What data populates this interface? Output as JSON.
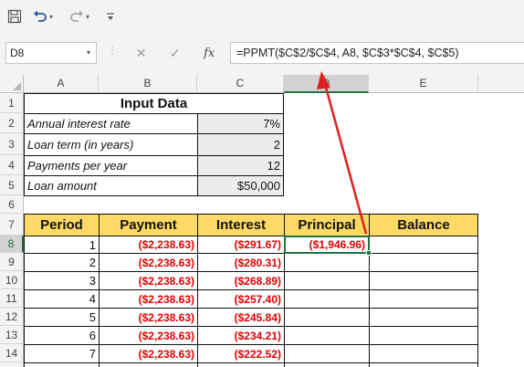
{
  "toolbar": {
    "save_icon": "save-icon",
    "undo_icon": "undo-icon",
    "redo_icon": "redo-icon",
    "customize_icon": "customize-qat-icon"
  },
  "formula_bar": {
    "name_box": "D8",
    "cancel_glyph": "✕",
    "enter_glyph": "✓",
    "fx_label": "fx",
    "formula": "=PPMT($C$2/$C$4, A8, $C$3*$C$4, $C$5)"
  },
  "columns": [
    "A",
    "B",
    "C",
    "D",
    "E"
  ],
  "rows": [
    "1",
    "2",
    "3",
    "4",
    "5",
    "6",
    "7",
    "8",
    "9",
    "10",
    "11",
    "12",
    "13",
    "14"
  ],
  "input": {
    "title": "Input Data",
    "labels": [
      "Annual interest rate",
      "Loan term (in years)",
      "Payments per year",
      "Loan amount"
    ],
    "values": [
      "7%",
      "2",
      "12",
      "$50,000"
    ]
  },
  "table": {
    "headers": [
      "Period",
      "Payment",
      "Interest",
      "Principal",
      "Balance"
    ],
    "rows": [
      {
        "period": "1",
        "payment": "($2,238.63)",
        "interest": "($291.67)",
        "principal": "($1,946.96)",
        "balance": ""
      },
      {
        "period": "2",
        "payment": "($2,238.63)",
        "interest": "($280.31)",
        "principal": "",
        "balance": ""
      },
      {
        "period": "3",
        "payment": "($2,238.63)",
        "interest": "($268.89)",
        "principal": "",
        "balance": ""
      },
      {
        "period": "4",
        "payment": "($2,238.63)",
        "interest": "($257.40)",
        "principal": "",
        "balance": ""
      },
      {
        "period": "5",
        "payment": "($2,238.63)",
        "interest": "($245.84)",
        "principal": "",
        "balance": ""
      },
      {
        "period": "6",
        "payment": "($2,238.63)",
        "interest": "($234.21)",
        "principal": "",
        "balance": ""
      },
      {
        "period": "7",
        "payment": "($2,238.63)",
        "interest": "($222.52)",
        "principal": "",
        "balance": ""
      }
    ]
  },
  "colors": {
    "header_fill": "#ffd966",
    "input_fill": "#ececec",
    "negative_text": "#e00000",
    "selection": "#217346",
    "arrow": "#e02020"
  }
}
